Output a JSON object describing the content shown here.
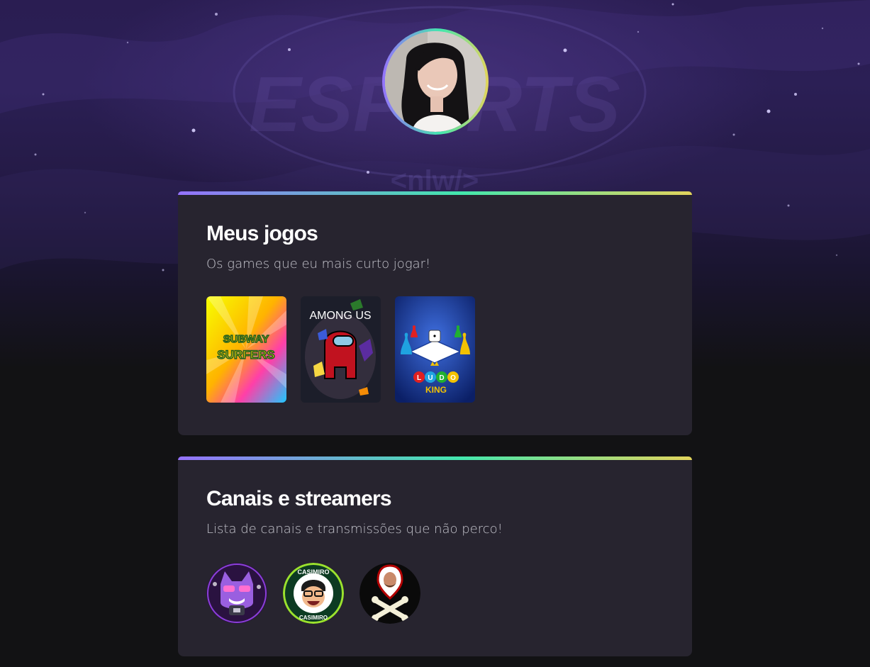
{
  "games_section": {
    "title": "Meus jogos",
    "subtitle": "Os games que eu mais curto jogar!",
    "games": [
      {
        "name": "Subway Surfers",
        "logo_top": "SUBWAY",
        "logo_bottom": "SURFERS"
      },
      {
        "name": "Among Us",
        "logo": "AMONG US"
      },
      {
        "name": "Ludo King",
        "letters": [
          "L",
          "U",
          "D",
          "O"
        ],
        "subtitle": "KING"
      }
    ]
  },
  "streams_section": {
    "title": "Canais e streamers",
    "subtitle": "Lista de canais e transmissões que não perco!",
    "channels": [
      {
        "name": "purple-cat-streamer",
        "icon": "purple-cat-icon"
      },
      {
        "name": "casimiro",
        "badge_text": "CASIMIRO"
      },
      {
        "name": "skull-streamer",
        "icon": "crossbones-icon"
      }
    ]
  },
  "background": {
    "watermark": "ESPORTS",
    "watermark_sub": "<nlw/>"
  },
  "colors": {
    "gradient": [
      "#9572fc",
      "#43e7ad",
      "#e2d45c"
    ],
    "card": "#27242f",
    "page": "#121214"
  }
}
